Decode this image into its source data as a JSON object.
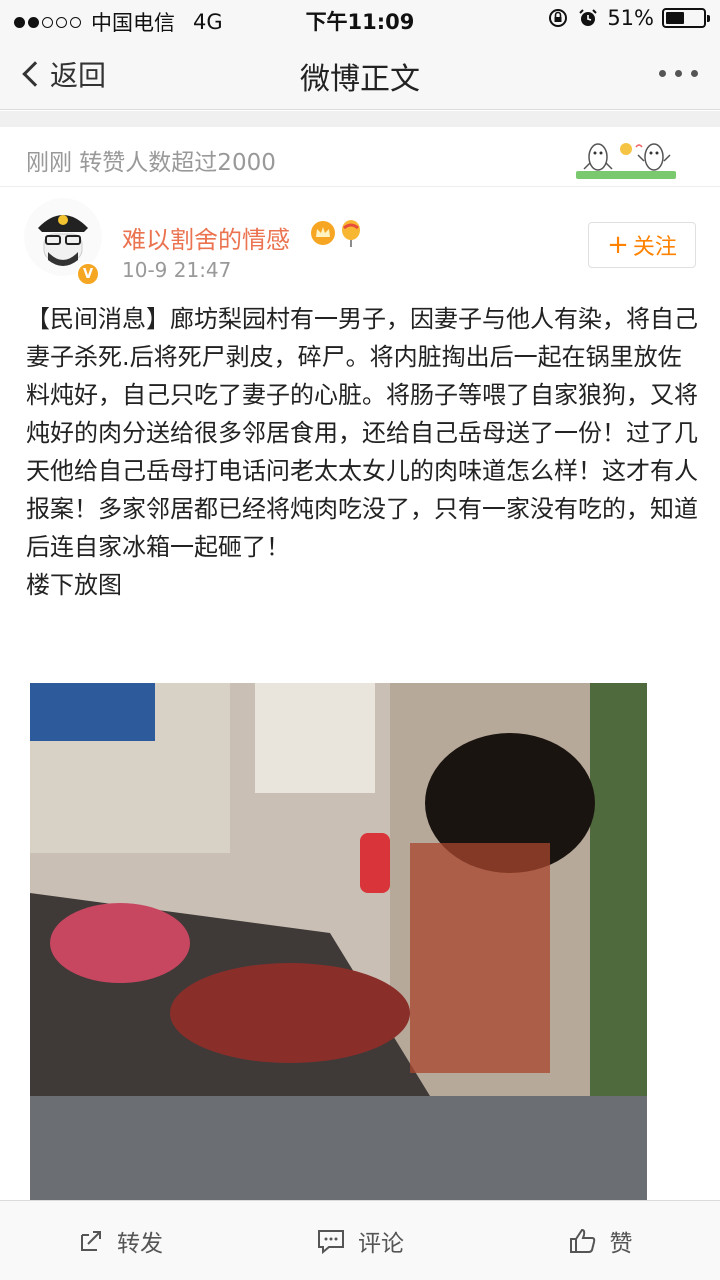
{
  "status_bar": {
    "carrier": "中国电信",
    "network": "4G",
    "time": "下午11:09",
    "battery_percent": 51,
    "battery_text": "51%",
    "signal_bars_filled": 2,
    "signal_bars_total": 5
  },
  "nav": {
    "back_label": "返回",
    "title": "微博正文"
  },
  "notification": {
    "text": "刚刚 转赞人数超过2000"
  },
  "post": {
    "author": "难以割舍的情感",
    "time": "10-9 21:47",
    "follow_label": "关注",
    "follow_plus": "+",
    "body": "【民间消息】廊坊梨园村有一男子，因妻子与他人有染，将自己妻子杀死.后将死尸剥皮，碎尸。将内脏掏出后一起在锅里放佐料炖好，自己只吃了妻子的心脏。将肠子等喂了自家狼狗，又将炖好的肉分送给很多邻居食用，还给自己岳母送了一份！过了几天他给自己岳母打电话问老太太女儿的肉味道怎么样！这才有人报案！多家邻居都已经将炖肉吃没了，只有一家没有吃的，知道后连自家冰箱一起砸了！\n楼下放图"
  },
  "toolbar": {
    "repost_label": "转发",
    "comment_label": "评论",
    "like_label": "赞"
  },
  "colors": {
    "author": "#eb7350",
    "follow": "#ff8200",
    "muted": "#999999"
  },
  "icons": [
    "back-chevron-icon",
    "more-icon",
    "alarm-icon",
    "lock-rotation-icon",
    "verified-icon",
    "crown-icon",
    "balloon-icon",
    "repost-icon",
    "comment-icon",
    "like-icon"
  ]
}
